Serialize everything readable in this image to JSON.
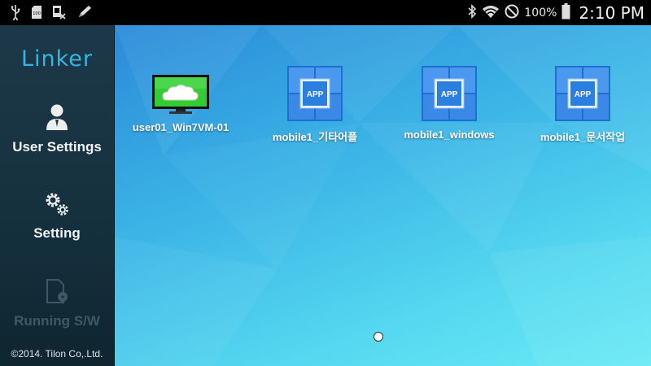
{
  "status_bar": {
    "battery_text": "100%",
    "time": "2:10 PM",
    "icons": [
      "usb-icon",
      "sd-card-icon",
      "sim-off-icon",
      "pencil-icon",
      "bluetooth-icon",
      "wifi-icon",
      "block-icon",
      "battery-icon"
    ]
  },
  "sidebar": {
    "logo": "Linker",
    "items": [
      {
        "label": "User Settings",
        "icon": "user-icon"
      },
      {
        "label": "Setting",
        "icon": "gears-icon"
      },
      {
        "label": "Running S/W",
        "icon": "document-disc-icon",
        "disabled": true
      }
    ],
    "copyright": "©2014. Tilon Co,.Ltd."
  },
  "desktop": {
    "apps": [
      {
        "label": "user01_Win7VM-01",
        "icon": "monitor-cloud-icon"
      },
      {
        "label": "mobile1_기타어플",
        "icon": "app-icon",
        "badge": "APP"
      },
      {
        "label": "mobile1_windows",
        "icon": "app-icon",
        "badge": "APP"
      },
      {
        "label": "mobile1_문서작업",
        "icon": "app-icon",
        "badge": "APP"
      }
    ],
    "page_indicator": {
      "current": 1,
      "total": 1
    }
  }
}
